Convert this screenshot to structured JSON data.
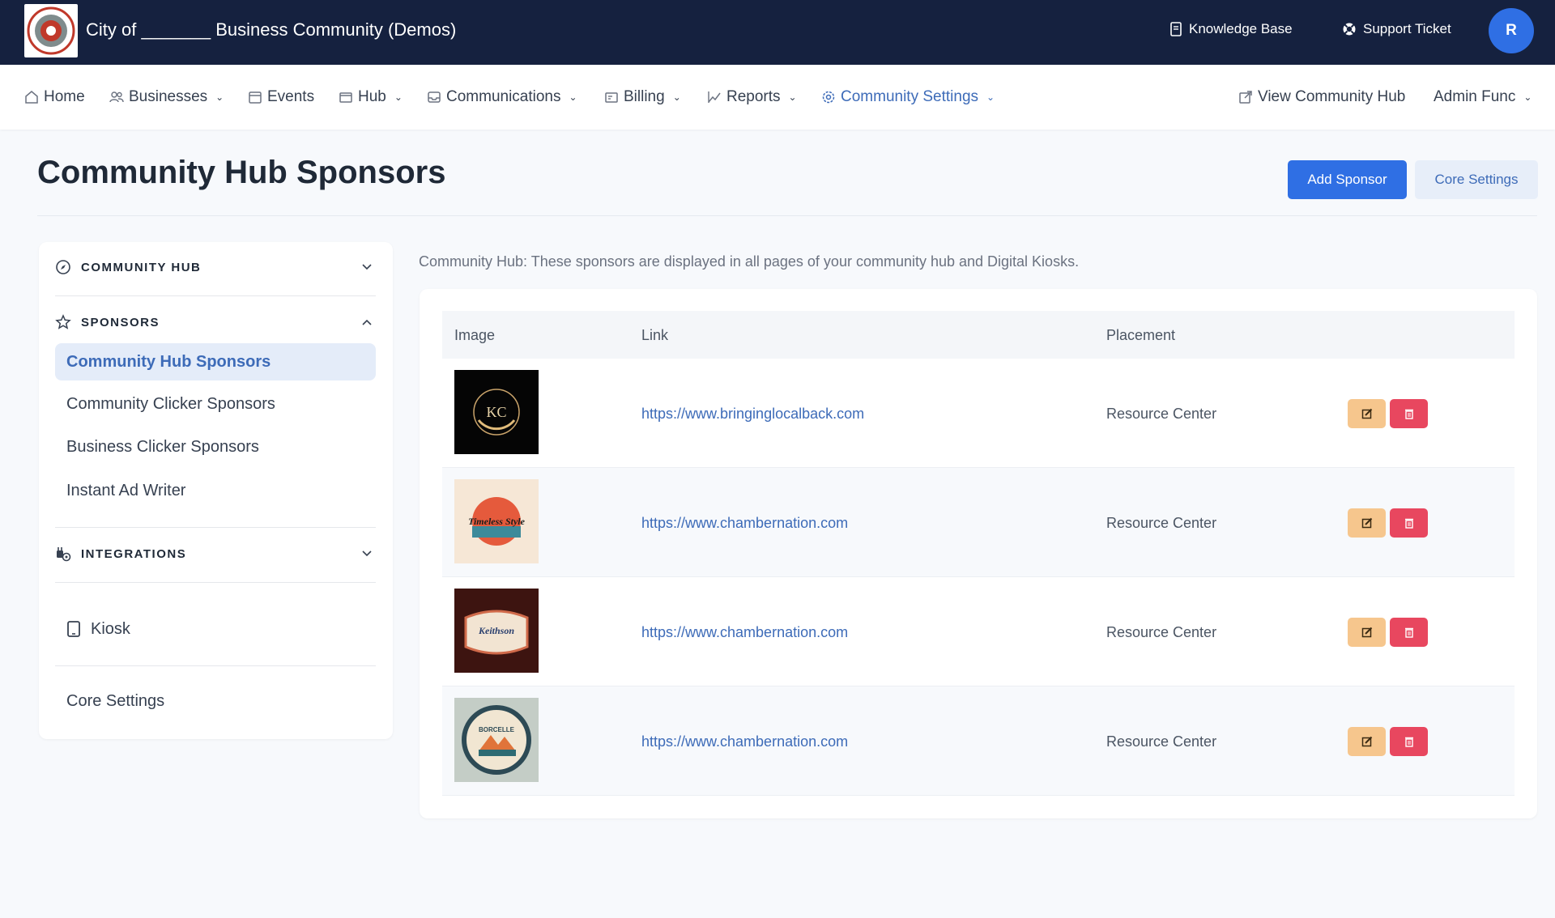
{
  "topbar": {
    "title": "City of _______ Business Community (Demos)",
    "knowledge_base": "Knowledge Base",
    "support_ticket": "Support Ticket",
    "avatar_initial": "R"
  },
  "nav": {
    "home": "Home",
    "businesses": "Businesses",
    "events": "Events",
    "hub": "Hub",
    "communications": "Communications",
    "billing": "Billing",
    "reports": "Reports",
    "community_settings": "Community Settings",
    "view_hub": "View Community Hub",
    "admin_func": "Admin Func"
  },
  "page": {
    "title": "Community Hub Sponsors",
    "add_button": "Add Sponsor",
    "core_button": "Core Settings",
    "description": "Community Hub: These sponsors are displayed in all pages of your community hub and Digital Kiosks."
  },
  "sidebar": {
    "community_hub": "COMMUNITY HUB",
    "sponsors": "SPONSORS",
    "sponsor_items": [
      "Community Hub Sponsors",
      "Community Clicker Sponsors",
      "Business Clicker Sponsors",
      "Instant Ad Writer"
    ],
    "integrations": "INTEGRATIONS",
    "kiosk": "Kiosk",
    "core_settings": "Core Settings"
  },
  "table": {
    "headers": {
      "image": "Image",
      "link": "Link",
      "placement": "Placement"
    },
    "rows": [
      {
        "link": "https://www.bringinglocalback.com",
        "placement": "Resource Center",
        "logo_text": "KC"
      },
      {
        "link": "https://www.chambernation.com",
        "placement": "Resource Center",
        "logo_text": "Timeless Style"
      },
      {
        "link": "https://www.chambernation.com",
        "placement": "Resource Center",
        "logo_text": "Keithson"
      },
      {
        "link": "https://www.chambernation.com",
        "placement": "Resource Center",
        "logo_text": "BORCELLE"
      }
    ]
  },
  "colors": {
    "topbar": "#15213f",
    "primary": "#2f6fe4",
    "accent_text": "#3d6bb8",
    "edit_button": "#f6c68d",
    "delete_button": "#e8475f"
  }
}
